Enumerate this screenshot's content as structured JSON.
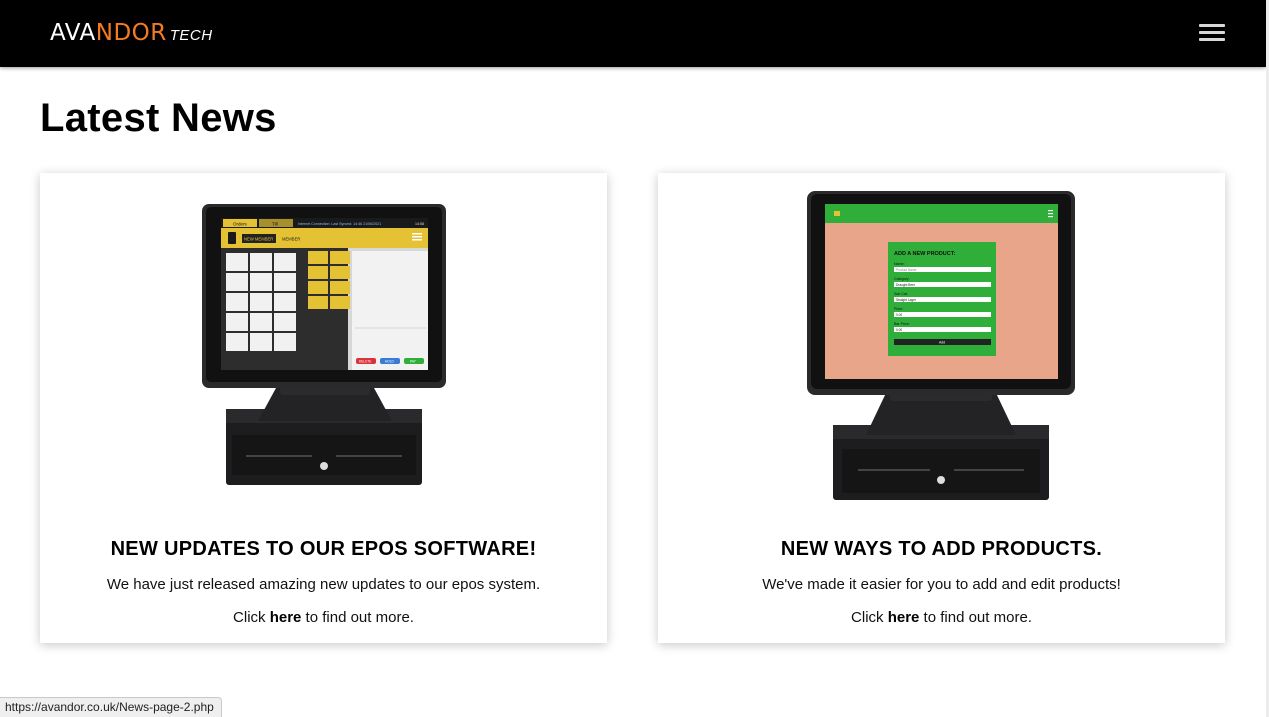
{
  "navbar": {
    "logo": {
      "ava": "AVA",
      "ndor": "NDOR",
      "tech": "TECH"
    },
    "menu_icon": "hamburger-menu-icon"
  },
  "page": {
    "title": "Latest News"
  },
  "cards": [
    {
      "title": "NEW UPDATES TO OUR EPOS SOFTWARE!",
      "description": "We have just released amazing new updates to our epos system.",
      "more_prefix": "Click ",
      "more_link": "here",
      "more_suffix": " to find out more.",
      "image_icon": "epos-terminal-image",
      "screen": {
        "tab1": "Orders",
        "tab2": "Till",
        "status": "Internet Connection:  Last Synced: 14:46 21/06/2021",
        "time": "14:58",
        "btn1": "NEW MEMBER",
        "btn2": "MEMBER",
        "actions": [
          "DELETE",
          "HOLD",
          "PAY"
        ]
      }
    },
    {
      "title": "NEW WAYS TO ADD PRODUCTS.",
      "description": "We've made it easier for you to add and edit products!",
      "more_prefix": "Click ",
      "more_link": "here",
      "more_suffix": " to find out more.",
      "image_icon": "epos-terminal-image",
      "screen": {
        "form_title": "ADD A NEW PRODUCT:",
        "fields": [
          "Name:",
          "Category:",
          "Sub Cat:",
          "Price:",
          "Bar Price:"
        ],
        "values": [
          "Product Name",
          "Draught Beer",
          "Straight Lager",
          "0.00",
          "0.00"
        ],
        "submit": "Add"
      }
    }
  ],
  "status_bar": {
    "url": "https://avandor.co.uk/News-page-2.php"
  },
  "colors": {
    "accent": "#f47c20",
    "nav_bg": "#000000",
    "screen_yellow": "#e4c234",
    "screen_green": "#2fae3a",
    "screen_salmon": "#e9a58a"
  }
}
